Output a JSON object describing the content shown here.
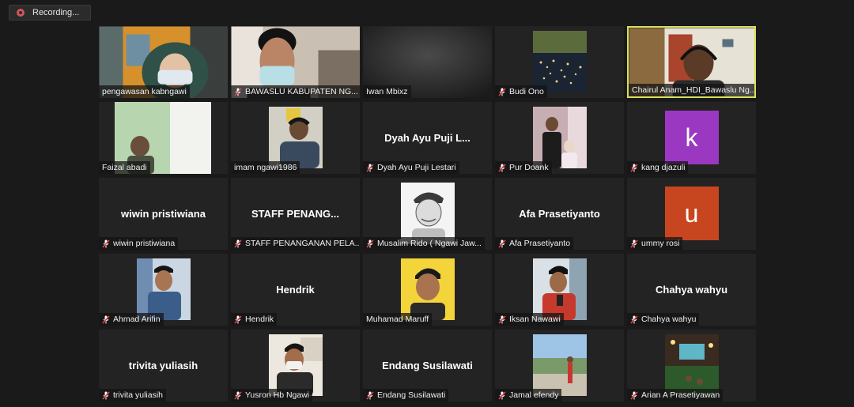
{
  "recording": {
    "label": "Recording..."
  },
  "colors": {
    "speaking_border": "#d6e05a",
    "muted_icon": "#e0434b",
    "avatar_purple": "#9b38c2",
    "avatar_orange": "#c8461f"
  },
  "participants": [
    {
      "name": "pengawasan kabngawi",
      "muted": false,
      "display": "photo"
    },
    {
      "name": "BAWASLU KABUPATEN NG...",
      "muted": true,
      "display": "photo"
    },
    {
      "name": "Iwan Mbixz",
      "muted": false,
      "display": "photo"
    },
    {
      "name": "Budi Ono",
      "muted": true,
      "display": "photo"
    },
    {
      "name": "Chairul Anam_HDI_Bawaslu Ng...",
      "muted": false,
      "display": "photo",
      "speaking": true
    },
    {
      "name": "Faizal abadi",
      "muted": false,
      "display": "photo"
    },
    {
      "name": "imam ngawi1986",
      "muted": false,
      "display": "photo"
    },
    {
      "name": "Dyah Ayu Puji Lestari",
      "muted": true,
      "display": "text",
      "center_text": "Dyah Ayu Puji L..."
    },
    {
      "name": "Pur Doank",
      "muted": true,
      "display": "photo"
    },
    {
      "name": "kang djazuli",
      "muted": true,
      "display": "letter",
      "letter": "k",
      "letter_color": "#9b38c2"
    },
    {
      "name": "wiwin pristiwiana",
      "muted": true,
      "display": "text",
      "center_text": "wiwin pristiwiana"
    },
    {
      "name": "STAFF PENANGANAN PELA...",
      "muted": true,
      "display": "text",
      "center_text": "STAFF PENANG..."
    },
    {
      "name": "Musalim Rido ( Ngawi Jaw...",
      "muted": true,
      "display": "photo"
    },
    {
      "name": "Afa Prasetiyanto",
      "muted": true,
      "display": "text",
      "center_text": "Afa Prasetiyanto"
    },
    {
      "name": "ummy rosi",
      "muted": true,
      "display": "letter",
      "letter": "u",
      "letter_color": "#c8461f"
    },
    {
      "name": "Ahmad Arifin",
      "muted": true,
      "display": "photo"
    },
    {
      "name": "Hendrik",
      "muted": true,
      "display": "text",
      "center_text": "Hendrik"
    },
    {
      "name": "Muhamad Maruff",
      "muted": false,
      "display": "photo"
    },
    {
      "name": "Iksan Nawawi",
      "muted": true,
      "display": "photo"
    },
    {
      "name": "Chahya wahyu",
      "muted": true,
      "display": "text",
      "center_text": "Chahya wahyu"
    },
    {
      "name": "trivita yuliasih",
      "muted": true,
      "display": "text",
      "center_text": "trivita yuliasih"
    },
    {
      "name": "Yusron Hb Ngawi",
      "muted": true,
      "display": "photo"
    },
    {
      "name": "Endang Susilawati",
      "muted": true,
      "display": "text",
      "center_text": "Endang Susilawati"
    },
    {
      "name": "Jamal efendy",
      "muted": true,
      "display": "photo"
    },
    {
      "name": "Arian A Prasetiyawan",
      "muted": true,
      "display": "photo"
    }
  ]
}
